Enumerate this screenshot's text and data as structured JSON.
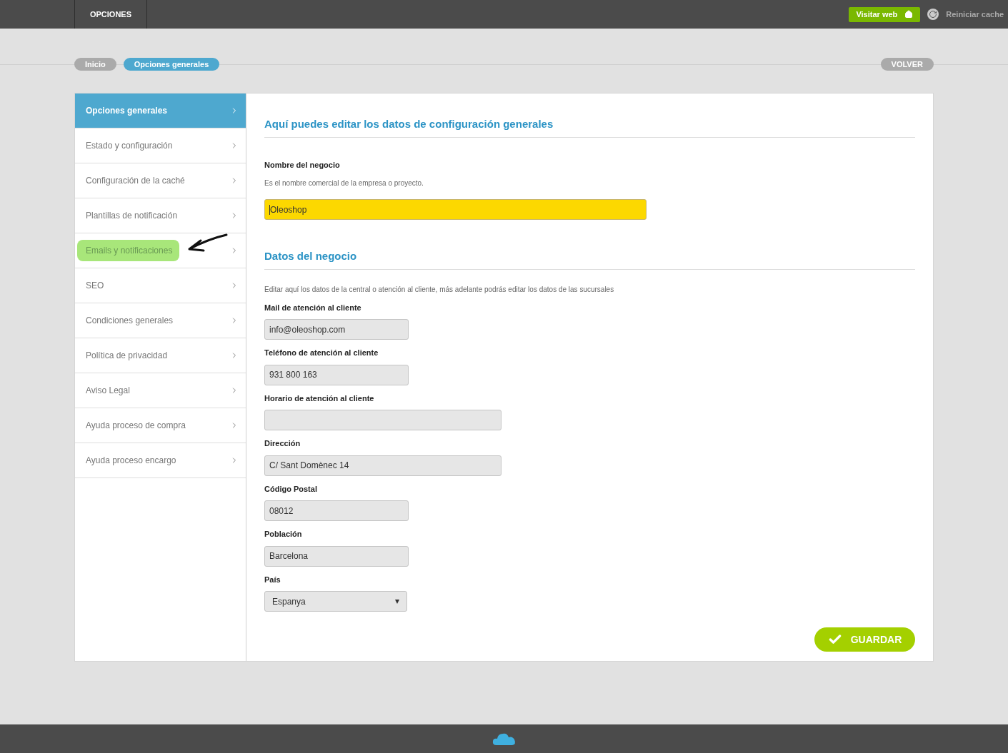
{
  "topbar": {
    "tab": "OPCIONES",
    "visit_button": "Visitar web",
    "reset_cache": "Reiniciar cache"
  },
  "breadcrumbs": [
    {
      "label": "Inicio",
      "selected": false
    },
    {
      "label": "Opciones generales",
      "selected": true
    }
  ],
  "back_button": "VOLVER",
  "sidebar": {
    "items": [
      {
        "label": "Opciones generales",
        "selected": true,
        "highlighted": false
      },
      {
        "label": "Estado y configuración",
        "selected": false,
        "highlighted": false
      },
      {
        "label": "Configuración de la caché",
        "selected": false,
        "highlighted": false
      },
      {
        "label": "Plantillas de notificación",
        "selected": false,
        "highlighted": false
      },
      {
        "label": "Emails y notificaciones",
        "selected": false,
        "highlighted": true
      },
      {
        "label": "SEO",
        "selected": false,
        "highlighted": false
      },
      {
        "label": "Condiciones generales",
        "selected": false,
        "highlighted": false
      },
      {
        "label": "Política de privacidad",
        "selected": false,
        "highlighted": false
      },
      {
        "label": "Aviso Legal",
        "selected": false,
        "highlighted": false
      },
      {
        "label": "Ayuda proceso de compra",
        "selected": false,
        "highlighted": false
      },
      {
        "label": "Ayuda proceso encargo",
        "selected": false,
        "highlighted": false
      }
    ]
  },
  "main": {
    "title": "Aquí puedes editar los datos de configuración generales",
    "business_name": {
      "label": "Nombre del negocio",
      "help": "Es el nombre comercial de la empresa o proyecto.",
      "value": "Oleoshop",
      "focused": true
    },
    "section_title": "Datos del negocio",
    "section_help": "Editar aquí los datos de la central o atención al cliente, más adelante podrás editar los datos de las sucursales",
    "fields": [
      {
        "kind": "text",
        "label": "Mail de atención al cliente",
        "value": "info@oleoshop.com"
      },
      {
        "kind": "text",
        "label": "Teléfono de atención al cliente",
        "value": "931 800 163"
      },
      {
        "kind": "wide",
        "label": "Horario de atención al cliente"
      },
      {
        "kind": "wide",
        "label": "Dirección",
        "value": "C/ Sant Domènec 14"
      },
      {
        "kind": "text",
        "label": "Código Postal",
        "value": "08012"
      },
      {
        "kind": "text",
        "label": "Población",
        "value": "Barcelona"
      },
      {
        "kind": "select",
        "label": "País",
        "value": "Espanya"
      }
    ],
    "save_button": "GUARDAR"
  }
}
